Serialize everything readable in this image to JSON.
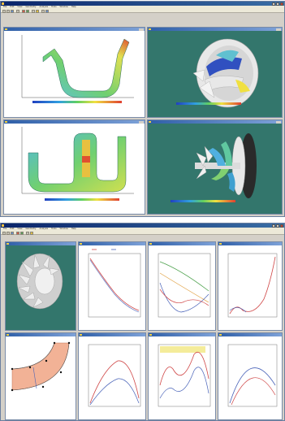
{
  "app1": {
    "menu": [
      "File",
      "Edit",
      "View",
      "Geometry",
      "Analysis",
      "Tools",
      "Window",
      "Help"
    ]
  },
  "app2": {
    "menu": [
      "File",
      "Edit",
      "View",
      "Geometry",
      "Analysis",
      "Tools",
      "Window",
      "Help"
    ],
    "plots": {
      "p4": {
        "legend_colors": [
          "#d04040",
          "#4060b0",
          "#40a040",
          "#e0a030"
        ]
      }
    }
  },
  "colors": {
    "app_title": "#0a246a",
    "pane_title": "#2f5fa8",
    "workspace": "#d4d0c8",
    "teal_bg": "#33766c",
    "series_red": "#d04848",
    "series_blue": "#4862b8",
    "series_green": "#4aa04a",
    "series_orange": "#e0a040",
    "highlight_band": "#f4ec9a",
    "meridional_fill": "#f2b296"
  },
  "icons": [
    "app-icon",
    "minimize-icon",
    "maximize-icon",
    "close-icon",
    "pane-icon",
    "impeller-3d-icon",
    "turbine-3d-icon"
  ]
}
